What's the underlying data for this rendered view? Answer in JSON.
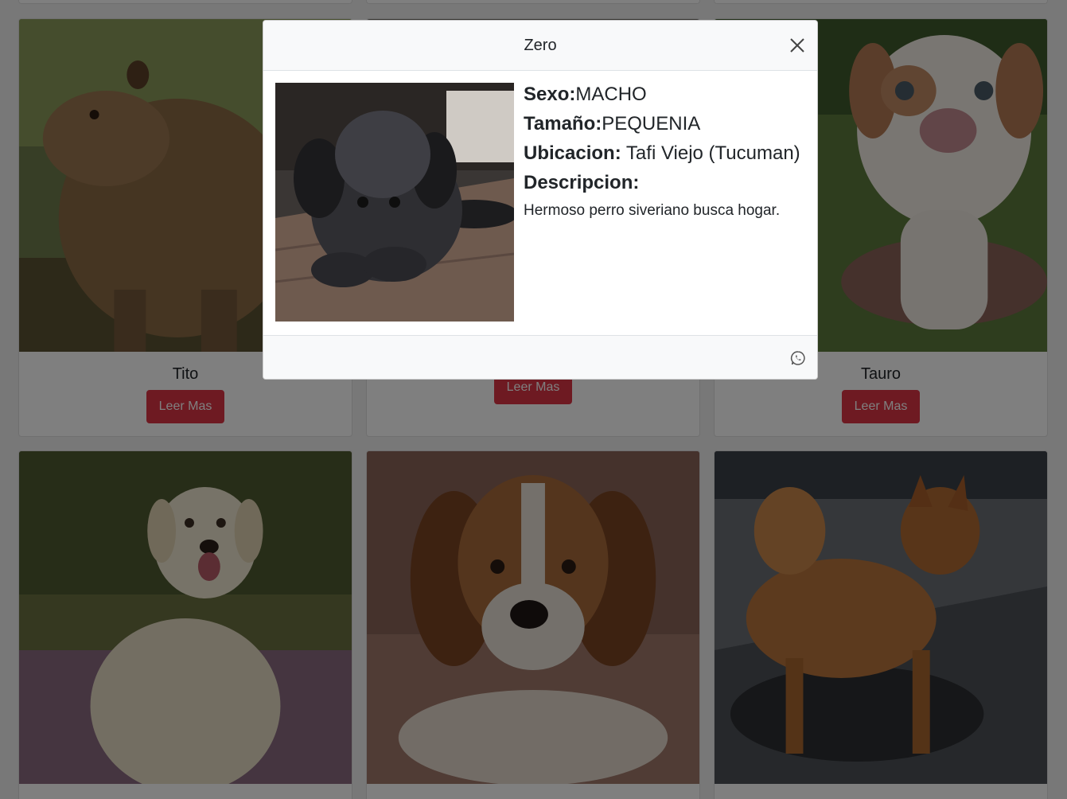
{
  "cards": [
    {
      "name": "",
      "button": ""
    },
    {
      "name": "",
      "button": ""
    },
    {
      "name": "",
      "button": ""
    },
    {
      "name": "Tito",
      "button": "Leer Mas",
      "image": "capybara-photo"
    },
    {
      "name": "",
      "button": "Leer Mas",
      "image": "dog-photo"
    },
    {
      "name": "Tauro",
      "button": "Leer Mas",
      "image": "puppy-photo"
    },
    {
      "name": "",
      "button": "",
      "image": "labrador-photo"
    },
    {
      "name": "",
      "button": "",
      "image": "beagle-photo"
    },
    {
      "name": "",
      "button": "",
      "image": "spitz-dog-photo"
    }
  ],
  "modal": {
    "title": "Zero",
    "image": "black-puppy-photo",
    "sexo_label": "Sexo:",
    "sexo_value": "MACHO",
    "tamano_label": "Tamaño:",
    "tamano_value": "PEQUENIA",
    "ubicacion_label": "Ubicacion:",
    "ubicacion_value": " Tafi Viejo (Tucuman)",
    "descripcion_label": "Descripcion:",
    "descripcion_value": "Hermoso perro siveriano busca hogar.",
    "close_icon": "close-icon",
    "footer_icon": "whatsapp-icon"
  },
  "colors": {
    "button": "#dc3545",
    "backdrop": "rgba(0,0,0,0.5)",
    "modal_header": "#f8f9fa"
  }
}
